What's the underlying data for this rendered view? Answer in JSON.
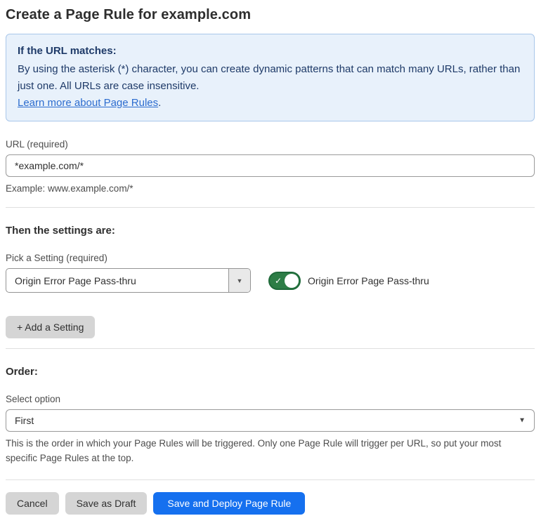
{
  "page": {
    "title": "Create a Page Rule for example.com"
  },
  "info_box": {
    "heading": "If the URL matches:",
    "body": "By using the asterisk (*) character, you can create dynamic patterns that can match many URLs, rather than just one. All URLs are case insensitive.",
    "link_label": "Learn more about Page Rules",
    "link_suffix": "."
  },
  "url_field": {
    "label": "URL (required)",
    "value": "*example.com/*",
    "helper": "Example: www.example.com/*"
  },
  "settings_section": {
    "heading": "Then the settings are:",
    "pick_label": "Pick a Setting (required)",
    "selected_setting": "Origin Error Page Pass-thru",
    "toggle_label": "Origin Error Page Pass-thru",
    "toggle_state": "on",
    "add_button_label": "+ Add a Setting"
  },
  "order_section": {
    "heading": "Order:",
    "select_label": "Select option",
    "selected_option": "First",
    "helper": "This is the order in which your Page Rules will be triggered. Only one Page Rule will trigger per URL, so put your most specific Page Rules at the top."
  },
  "footer": {
    "cancel_label": "Cancel",
    "save_draft_label": "Save as Draft",
    "save_deploy_label": "Save and Deploy Page Rule"
  },
  "icons": {
    "check": "✓",
    "dropdown_arrow": "▼"
  },
  "colors": {
    "info_bg": "#e8f1fb",
    "info_border": "#a9c7ea",
    "info_text": "#1e3a68",
    "link_blue": "#2c6ccf",
    "toggle_green": "#2d7d46",
    "toggle_green_border": "#1f6a3a",
    "primary_blue": "#1570ef",
    "button_gray": "#d5d5d5"
  }
}
